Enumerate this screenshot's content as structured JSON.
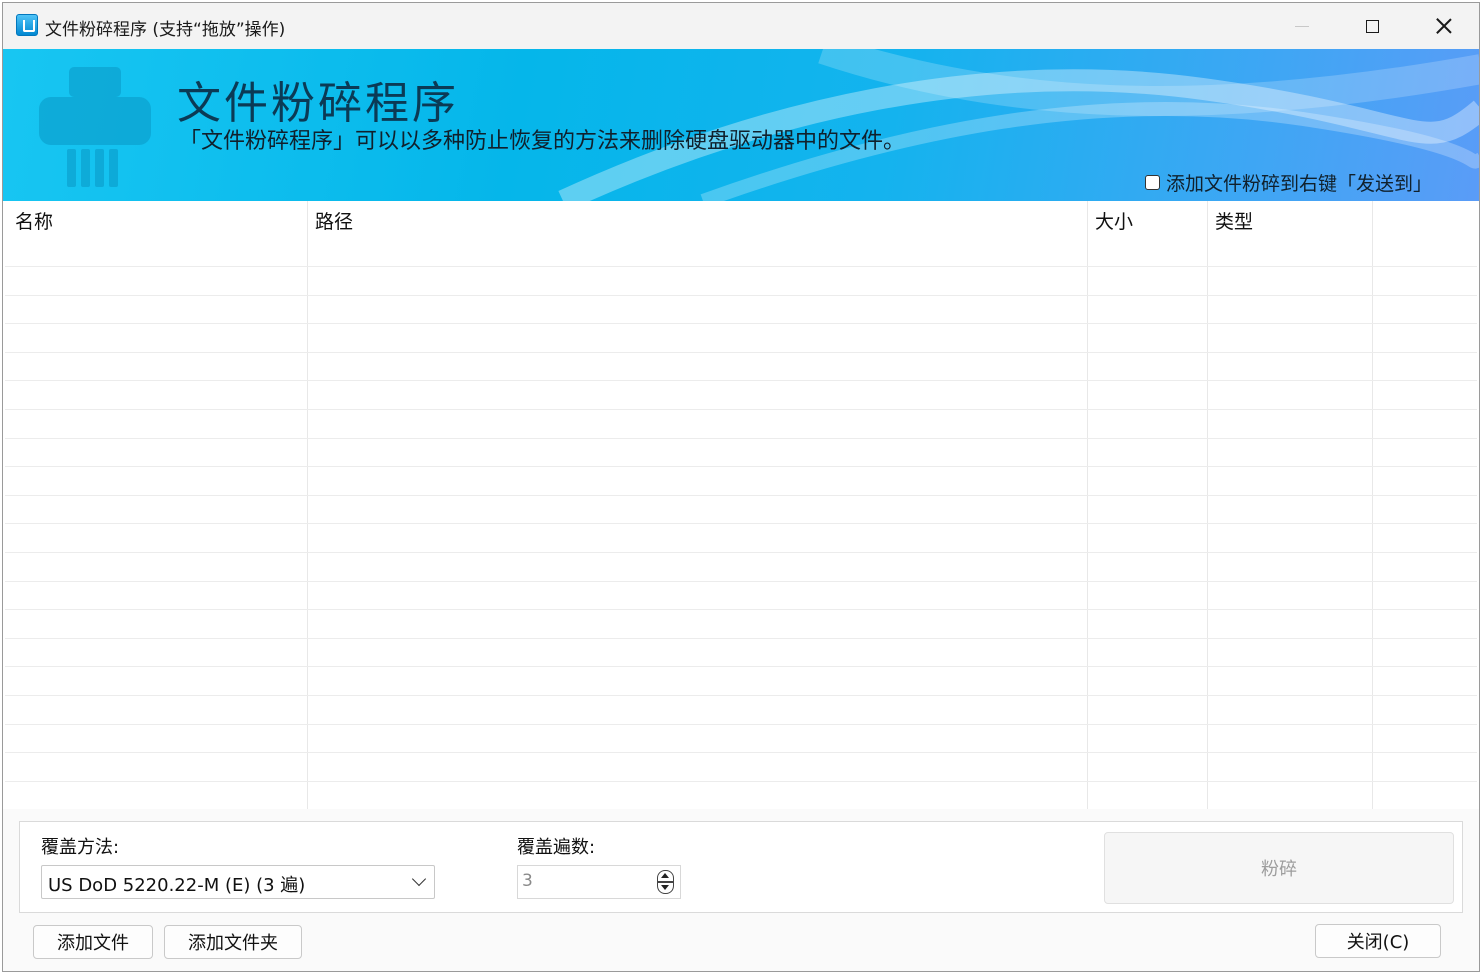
{
  "window": {
    "title": "文件粉碎程序 (支持“拖放”操作)"
  },
  "banner": {
    "title": "文件粉碎程序",
    "description": "「文件粉碎程序」可以以多种防止恢复的方法来删除硬盘驱动器中的文件。",
    "sendto_label": "添加文件粉碎到右键「发送到」",
    "sendto_checked": false
  },
  "list": {
    "columns": [
      "名称",
      "路径",
      "大小",
      "类型"
    ],
    "rows": []
  },
  "options": {
    "method_label": "覆盖方法:",
    "method_value": "US DoD 5220.22-M (E) (3 遍)",
    "passes_label": "覆盖遍数:",
    "passes_value": "3"
  },
  "buttons": {
    "shred": "粉碎",
    "add_file": "添加文件",
    "add_folder": "添加文件夹",
    "close": "关闭(C)"
  }
}
